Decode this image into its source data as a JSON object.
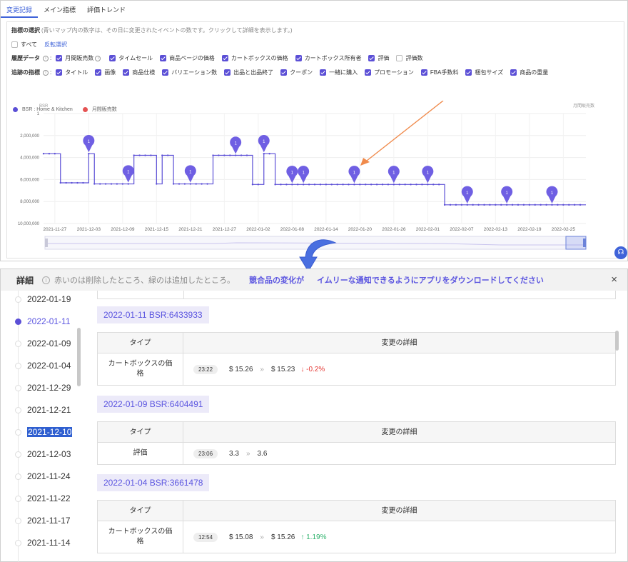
{
  "tabs": [
    "変更記録",
    "メイン指標",
    "評価トレンド"
  ],
  "filter": {
    "title": "指標の選択",
    "hint": "(青いマップ内の数字は、その日に変更されたイベントの数です。クリックして詳細を表示します。)",
    "all_label": "すべて",
    "invert_label": "反転選択",
    "history_label": "履歴データ",
    "history_items": [
      {
        "label": "月間販売数",
        "checked": true
      },
      {
        "label": "タイムセール",
        "checked": true
      },
      {
        "label": "商品ページの価格",
        "checked": true
      },
      {
        "label": "カートボックスの価格",
        "checked": true
      },
      {
        "label": "カートボックス所有者",
        "checked": true
      },
      {
        "label": "評価",
        "checked": true
      },
      {
        "label": "評価数",
        "checked": false
      }
    ],
    "track_label": "追跡の指標",
    "track_items": [
      {
        "label": "タイトル",
        "checked": true
      },
      {
        "label": "画像",
        "checked": true
      },
      {
        "label": "商品仕様",
        "checked": true
      },
      {
        "label": "バリエーション数",
        "checked": true
      },
      {
        "label": "出品と出品終了",
        "checked": true
      },
      {
        "label": "クーポン",
        "checked": true
      },
      {
        "label": "一緒に購入",
        "checked": true
      },
      {
        "label": "プロモーション",
        "checked": true
      },
      {
        "label": "FBA手数料",
        "checked": true
      },
      {
        "label": "梱包サイズ",
        "checked": true
      },
      {
        "label": "商品の重量",
        "checked": true
      }
    ]
  },
  "chart_data": {
    "type": "line",
    "series": [
      {
        "name": "BSR : Home & Kitchen",
        "color": "#5b4fd6"
      },
      {
        "name": "月間販売数",
        "color": "#e55353"
      }
    ],
    "ylabel_left": "BSR",
    "ylabel_right": "月間販売数",
    "y_ticks": [
      "1",
      "2,000,000",
      "4,000,000",
      "6,000,000",
      "8,000,000",
      "10,000,000"
    ],
    "ylim": [
      0,
      10000000
    ],
    "y_inverted": true,
    "x_ticks": [
      "2021-11-27",
      "2021-12-03",
      "2021-12-09",
      "2021-12-15",
      "2021-12-21",
      "2021-12-27",
      "2022-01-02",
      "2022-01-08",
      "2022-01-14",
      "2022-01-20",
      "2022-01-26",
      "2022-02-01",
      "2022-02-07",
      "2022-02-13",
      "2022-02-19",
      "2022-02-25"
    ],
    "xlim": [
      "2021-11-25",
      "2022-03-01"
    ],
    "steps": [
      {
        "date": "2021-11-25",
        "value": 3650000
      },
      {
        "date": "2021-11-28",
        "value": 6300000
      },
      {
        "date": "2021-12-03",
        "value": 3650000
      },
      {
        "date": "2021-12-04",
        "value": 6400000
      },
      {
        "date": "2021-12-10",
        "value": 6400000
      },
      {
        "date": "2021-12-11",
        "value": 3800000
      },
      {
        "date": "2021-12-15",
        "value": 6400000
      },
      {
        "date": "2021-12-16",
        "value": 3800000
      },
      {
        "date": "2021-12-18",
        "value": 6400000
      },
      {
        "date": "2021-12-24",
        "value": 6400000
      },
      {
        "date": "2021-12-25",
        "value": 3800000
      },
      {
        "date": "2022-01-01",
        "value": 6450000
      },
      {
        "date": "2022-01-03",
        "value": 3650000
      },
      {
        "date": "2022-01-05",
        "value": 6450000
      },
      {
        "date": "2022-02-04",
        "value": 8300000
      },
      {
        "date": "2022-03-01",
        "value": 8300000
      }
    ],
    "event_markers": [
      {
        "date": "2021-12-03",
        "count": 1
      },
      {
        "date": "2021-12-10",
        "count": 1
      },
      {
        "date": "2021-12-21",
        "count": 1
      },
      {
        "date": "2021-12-29",
        "count": 1
      },
      {
        "date": "2022-01-03",
        "count": 1
      },
      {
        "date": "2022-01-08",
        "count": 1
      },
      {
        "date": "2022-01-10",
        "count": 1
      },
      {
        "date": "2022-01-19",
        "count": 1
      },
      {
        "date": "2022-01-26",
        "count": 1
      },
      {
        "date": "2022-02-01",
        "count": 1
      },
      {
        "date": "2022-02-08",
        "count": 1
      },
      {
        "date": "2022-02-15",
        "count": 1
      },
      {
        "date": "2022-02-23",
        "count": 1
      }
    ],
    "annotation_arrow_color": "#f08a4b",
    "grid": true
  },
  "details": {
    "title": "詳細",
    "note": "赤いのは削除したところ、緑のは追加したところ。",
    "ad_before": "競合品の変化が",
    "ad_after": "イムリーな通知できるようにアプリをダウンロードしてください",
    "close": "×",
    "timeline": [
      "2022-01-19",
      "2022-01-11",
      "2022-01-09",
      "2022-01-04",
      "2021-12-29",
      "2021-12-21",
      "2021-12-10",
      "2021-12-03",
      "2021-11-24",
      "2021-11-22",
      "2021-11-17",
      "2021-11-14"
    ],
    "header_type": "タイプ",
    "header_detail": "変更の詳細",
    "sections": [
      {
        "label": "2022-01-11 BSR:6433933",
        "type": "カートボックスの価格",
        "time": "23:22",
        "from": "$ 15.26",
        "to": "$ 15.23",
        "change": "-0.2%",
        "dir": "down"
      },
      {
        "label": "2022-01-09 BSR:6404491",
        "type": "評価",
        "time": "23:06",
        "from": "3.3",
        "to": "3.6",
        "change": "",
        "dir": "none"
      },
      {
        "label": "2022-01-04 BSR:3661478",
        "type": "カートボックスの価格",
        "time": "12:54",
        "from": "$ 15.08",
        "to": "$ 15.26",
        "change": "1.19%",
        "dir": "up"
      }
    ]
  }
}
